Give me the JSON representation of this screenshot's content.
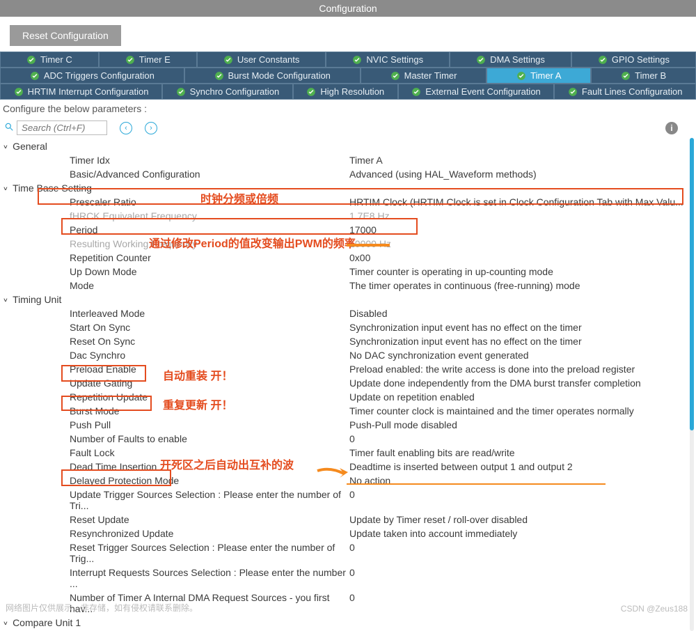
{
  "title": "Configuration",
  "reset_btn": "Reset Configuration",
  "tabs_row1": [
    {
      "label": "Timer C"
    },
    {
      "label": "Timer E"
    },
    {
      "label": "User Constants"
    },
    {
      "label": "NVIC Settings"
    },
    {
      "label": "DMA Settings"
    },
    {
      "label": "GPIO Settings"
    }
  ],
  "tabs_row2": [
    {
      "label": "ADC Triggers Configuration"
    },
    {
      "label": "Burst Mode Configuration"
    },
    {
      "label": "Master Timer"
    },
    {
      "label": "Timer A",
      "active": true
    },
    {
      "label": "Timer B"
    }
  ],
  "tabs_row3": [
    {
      "label": "HRTIM Interrupt Configuration"
    },
    {
      "label": "Synchro Configuration"
    },
    {
      "label": "High Resolution"
    },
    {
      "label": "External Event Configuration"
    },
    {
      "label": "Fault Lines Configuration"
    }
  ],
  "subheader": "Configure the below parameters :",
  "search": {
    "placeholder": "Search (Ctrl+F)"
  },
  "sections": {
    "general": {
      "title": "General",
      "rows": [
        {
          "label": "Timer Idx",
          "value": "Timer A"
        },
        {
          "label": "Basic/Advanced Configuration",
          "value": "Advanced (using HAL_Waveform methods)"
        }
      ]
    },
    "timebase": {
      "title": "Time Base Setting",
      "rows": [
        {
          "label": "Prescaler Ratio",
          "value": "HRTIM Clock (HRTIM Clock is set in Clock Configuration Tab with Max Valu..."
        },
        {
          "label": "fHRCK Equivalent Frequency",
          "value": "1.7E8 Hz",
          "faded": true
        },
        {
          "label": "Period",
          "value": "17000"
        },
        {
          "label": "Resulting Working Frequency",
          "value": "10000 Hz",
          "faded": true
        },
        {
          "label": "Repetition Counter",
          "value": "0x00"
        },
        {
          "label": "Up Down Mode",
          "value": "Timer counter is operating in up-counting mode"
        },
        {
          "label": "Mode",
          "value": "The timer operates in continuous (free-running) mode"
        }
      ]
    },
    "timing": {
      "title": "Timing Unit",
      "rows": [
        {
          "label": "Interleaved Mode",
          "value": "Disabled"
        },
        {
          "label": "Start On Sync",
          "value": "Synchronization input event has no effect on the timer"
        },
        {
          "label": "Reset On Sync",
          "value": "Synchronization input event has no effect on the timer"
        },
        {
          "label": "Dac Synchro",
          "value": "No DAC synchronization event generated"
        },
        {
          "label": "Preload Enable",
          "value": "Preload enabled: the write access is done into the preload register"
        },
        {
          "label": "Update Gating",
          "value": "Update done independently from the DMA burst transfer completion"
        },
        {
          "label": "Repetition Update",
          "value": "Update on repetition enabled"
        },
        {
          "label": "Burst Mode",
          "value": "Timer counter clock is maintained and the timer operates normally"
        },
        {
          "label": "Push Pull",
          "value": "Push-Pull mode disabled"
        },
        {
          "label": "Number of Faults to enable",
          "value": "0"
        },
        {
          "label": "Fault Lock",
          "value": "Timer fault enabling bits are read/write"
        },
        {
          "label": "Dead Time Insertion",
          "value": "Deadtime is inserted between output 1 and output 2"
        },
        {
          "label": "Delayed Protection Mode",
          "value": "No action"
        },
        {
          "label": "Update Trigger Sources Selection : Please enter the number of Tri...",
          "value": "0"
        },
        {
          "label": "Reset Update",
          "value": "Update by Timer reset / roll-over disabled"
        },
        {
          "label": "Resynchronized Update",
          "value": "Update taken into account immediately"
        },
        {
          "label": "Reset Trigger Sources Selection : Please enter the number of Trig...",
          "value": "0"
        },
        {
          "label": "Interrupt Requests Sources Selection : Please enter the number ...",
          "value": "0"
        },
        {
          "label": "Number of Timer A Internal DMA Request Sources  - you first hav...",
          "value": "0"
        }
      ]
    },
    "compare": {
      "title": "Compare Unit 1"
    }
  },
  "annotations": {
    "a1": "时钟分频或倍频",
    "a2": "通过修改Period的值改变输出PWM的频率",
    "a3": "自动重装   开！",
    "a4": "重复更新   开！",
    "a5": "开死区之后自动出互补的波"
  },
  "watermark": "网络图片仅供展示，非存储，如有侵权请联系删除。",
  "csdn": "CSDN @Zeus188"
}
